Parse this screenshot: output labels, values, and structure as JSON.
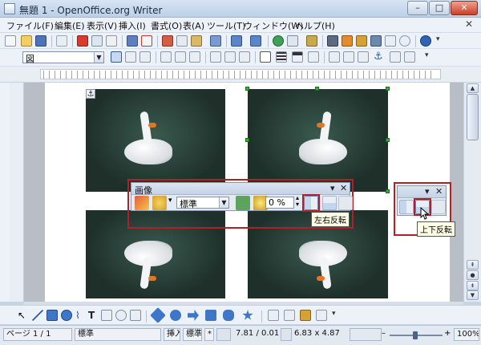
{
  "window": {
    "title": "無題 1 - OpenOffice.org Writer"
  },
  "menu": {
    "items": [
      "ファイル(F)",
      "編集(E)",
      "表示(V)",
      "挿入(I)",
      "書式(O)",
      "表(A)",
      "ツール(T)",
      "ウィンドウ(W)",
      "ヘルプ(H)"
    ]
  },
  "frame_toolbar": {
    "style_combo_value": "図"
  },
  "picture_toolbar": {
    "title": "画像",
    "graphics_mode": "標準",
    "transparency": "0 %",
    "tooltip_horizontal": "左右反転"
  },
  "small_toolbar": {
    "tooltip_vertical": "上下反転"
  },
  "status": {
    "page": "ページ 1 / 1",
    "page_style": "標準",
    "insert_mode": "挿入",
    "selection_mode": "標準",
    "modified_flag": "*",
    "position": "7.81 / 0.01",
    "size": "6.83 x 4.87",
    "zoom": "100%"
  },
  "icons": {
    "anchor": "⚓"
  },
  "colors": {
    "highlight": "#b1202a",
    "handle": "#2fb52f"
  }
}
